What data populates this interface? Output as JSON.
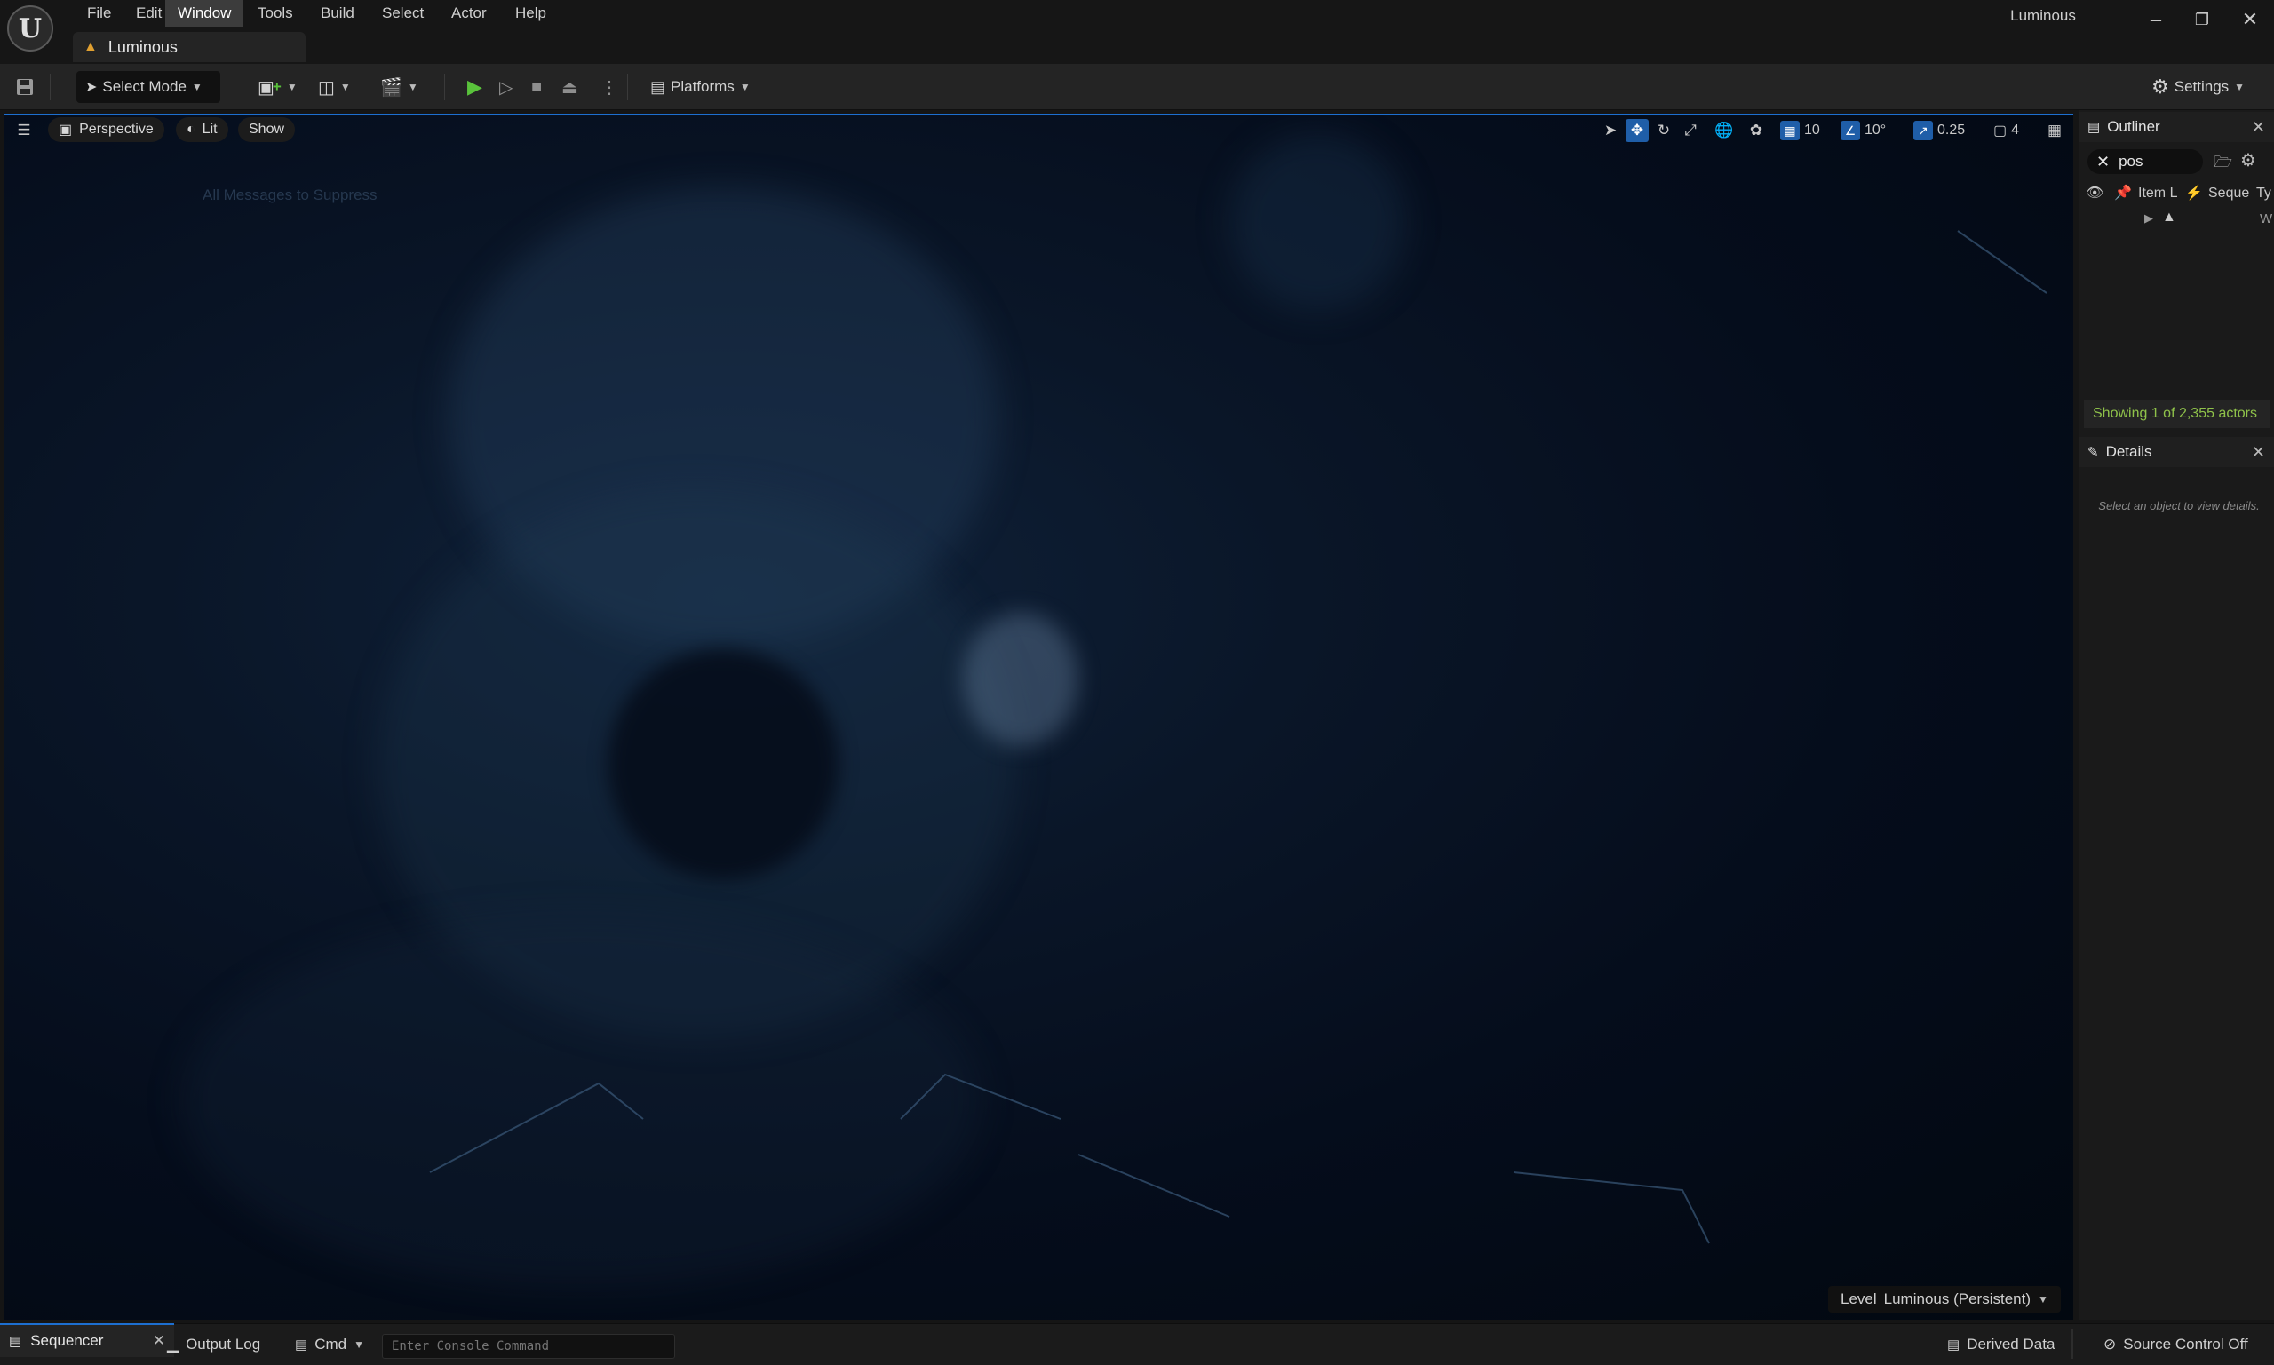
{
  "menu": {
    "items": [
      "File",
      "Edit",
      "Window",
      "Tools",
      "Build",
      "Select",
      "Actor",
      "Help"
    ],
    "active": "Window"
  },
  "project_tab": {
    "label": "Luminous"
  },
  "window": {
    "title": "Luminous"
  },
  "toolbar": {
    "mode_label": "Select Mode",
    "platforms_label": "Platforms",
    "settings_label": "Settings"
  },
  "viewport": {
    "perspective_label": "Perspective",
    "lit_label": "Lit",
    "show_label": "Show",
    "grid_snap": "10",
    "rotation_snap": "10°",
    "scale_snap": "0.25",
    "camera_speed": "4",
    "faint_message": "All Messages to Suppress",
    "level_label": "Level",
    "level_value": "Luminous (Persistent)"
  },
  "outliner": {
    "title": "Outliner",
    "search_value": "pos",
    "columns": [
      "Item L",
      "Seque",
      "Ty"
    ],
    "row_type_glyph": "W",
    "showing_text": "Showing 1 of 2,355 actors"
  },
  "details": {
    "title": "Details",
    "hint": "Select an object to view details."
  },
  "bottom": {
    "sequencer_tab": "Sequencer",
    "output_log": "Output Log",
    "cmd_label": "Cmd",
    "console_placeholder": "Enter Console Command",
    "derived_data": "Derived Data",
    "source_control": "Source Control Off"
  },
  "colors": {
    "accent": "#1f5ea8",
    "play_green": "#59c23b",
    "status_green": "#8fc24a",
    "viewport_bg": "#050d1c"
  }
}
